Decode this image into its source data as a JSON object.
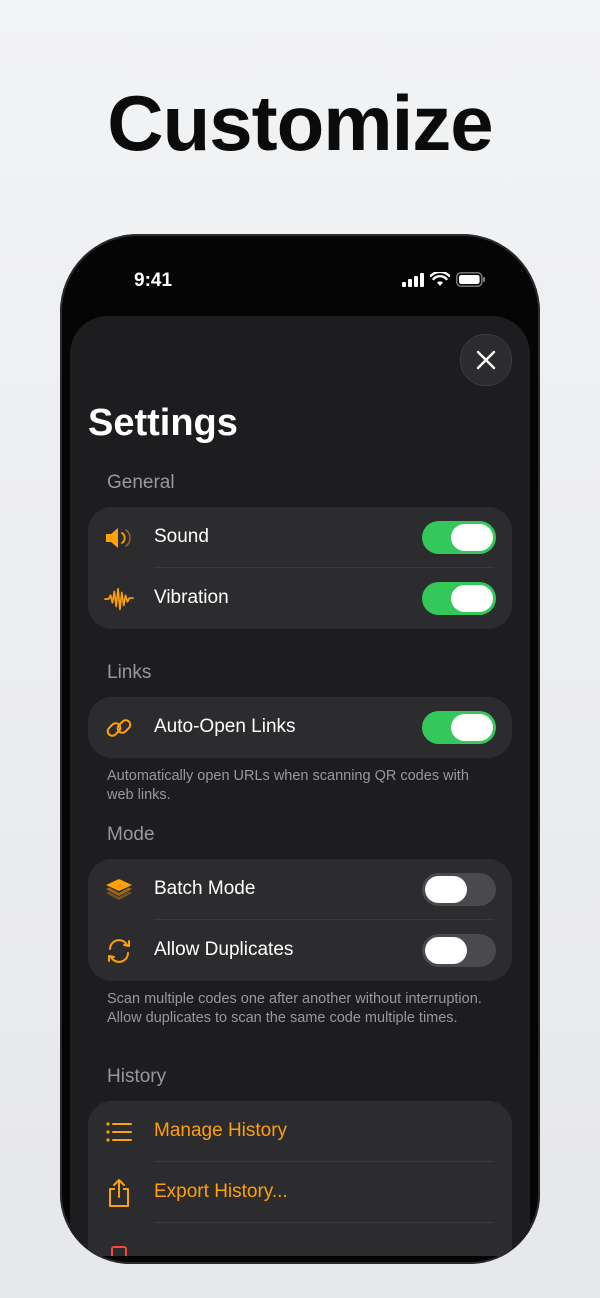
{
  "headline": "Customize",
  "status_bar": {
    "time": "9:41"
  },
  "sheet": {
    "title": "Settings",
    "sections": {
      "general": {
        "label": "General",
        "rows": [
          {
            "label": "Sound",
            "icon": "speaker-icon",
            "toggle": true
          },
          {
            "label": "Vibration",
            "icon": "waveform-icon",
            "toggle": true
          }
        ]
      },
      "links": {
        "label": "Links",
        "rows": [
          {
            "label": "Auto-Open Links",
            "icon": "link-icon",
            "toggle": true
          }
        ],
        "footnote": "Automatically open URLs when scanning QR codes with web links."
      },
      "mode": {
        "label": "Mode",
        "rows": [
          {
            "label": "Batch Mode",
            "icon": "layers-icon",
            "toggle": false
          },
          {
            "label": "Allow Duplicates",
            "icon": "repeat-icon",
            "toggle": false
          }
        ],
        "footnote": "Scan multiple codes one after another without interruption. Allow duplicates to scan the same code multiple times."
      },
      "history": {
        "label": "History",
        "rows": [
          {
            "label": "Manage History",
            "icon": "list-icon"
          },
          {
            "label": "Export History...",
            "icon": "share-icon"
          }
        ]
      }
    }
  },
  "colors": {
    "accent": "#ff9f0a",
    "toggle_on": "#34c759",
    "destructive": "#ff453a"
  }
}
